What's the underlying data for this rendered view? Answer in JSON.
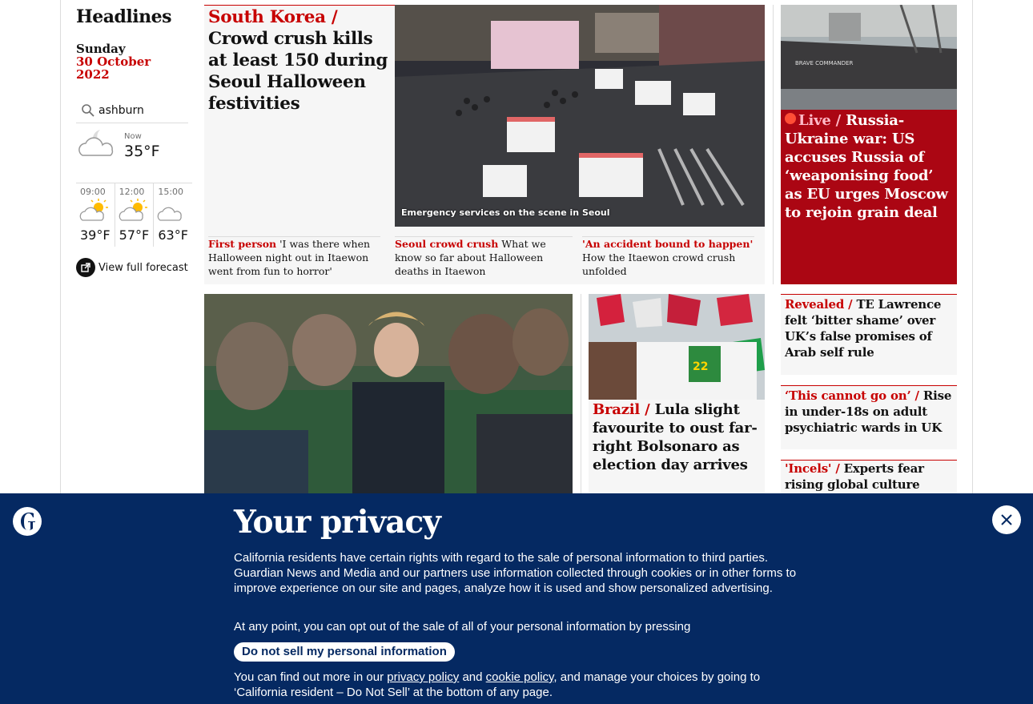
{
  "rail": {
    "title": "Headlines",
    "day": "Sunday",
    "date": "30 October 2022"
  },
  "weather": {
    "location": "ashburn",
    "now_label": "Now",
    "now_temp": "35°F",
    "forecast": [
      {
        "time": "09:00",
        "temp": "39°F",
        "icon": "sun-cloud-icon"
      },
      {
        "time": "12:00",
        "temp": "57°F",
        "icon": "sun-cloud-icon"
      },
      {
        "time": "15:00",
        "temp": "63°F",
        "icon": "cloud-icon"
      }
    ],
    "full_forecast_label": "View full forecast"
  },
  "lead": {
    "kicker": "South Korea /",
    "headline": "Crowd crush kills at least 150 during Seoul Halloween festivities",
    "image_caption": "Emergency services on the scene in Seoul",
    "subs": [
      {
        "kicker": "First person",
        "text": "'I was there when Halloween night out in Itaewon went from fun to horror'"
      },
      {
        "kicker": "Seoul crowd crush",
        "text": "What we know so far about Halloween deaths in Itaewon"
      },
      {
        "kicker": "'An accident bound to happen'",
        "text": "How the Itaewon crowd crush unfolded"
      }
    ]
  },
  "live": {
    "kicker": "Live /",
    "headline": "Russia-Ukraine war: US accuses Russia of ‘weaponising food’ as EU urges Moscow to rejoin grain deal",
    "image_text": "BRAVE COMMANDER"
  },
  "side_stories": [
    {
      "kicker": "Revealed /",
      "headline": "TE Lawrence felt ‘bitter shame’ over UK’s false promises of Arab self rule"
    },
    {
      "kicker": "‘This cannot go on’ /",
      "headline": "Rise in under-18s on adult psychiatric wards in UK"
    },
    {
      "kicker": "'Incels' /",
      "headline": "Experts fear rising global culture could"
    }
  ],
  "brazil": {
    "kicker": "Brazil /",
    "headline": "Lula slight favourite to oust far-right Bolsonaro as election day arrives",
    "badge": "22"
  },
  "privacy": {
    "title": "Your privacy",
    "para1": "California residents have certain rights with regard to the sale of personal information to third parties. Guardian News and Media and our partners use information collected through cookies or in other forms to improve experience on our site and pages, analyze how it is used and show personalized advertising.",
    "para2": "At any point, you can opt out of the sale of all of your personal information by pressing",
    "button": "Do not sell my personal information",
    "para3_start": "You can find out more in our",
    "privacy_link": "privacy policy",
    "and": "and",
    "cookie_link": "cookie policy",
    "para3_end": ", and manage your choices by going to ‘California resident – Do Not Sell’ at the bottom of any page."
  },
  "colors": {
    "news_red": "#c70000",
    "live_red": "#ab0613",
    "guardian_blue": "#052962"
  }
}
